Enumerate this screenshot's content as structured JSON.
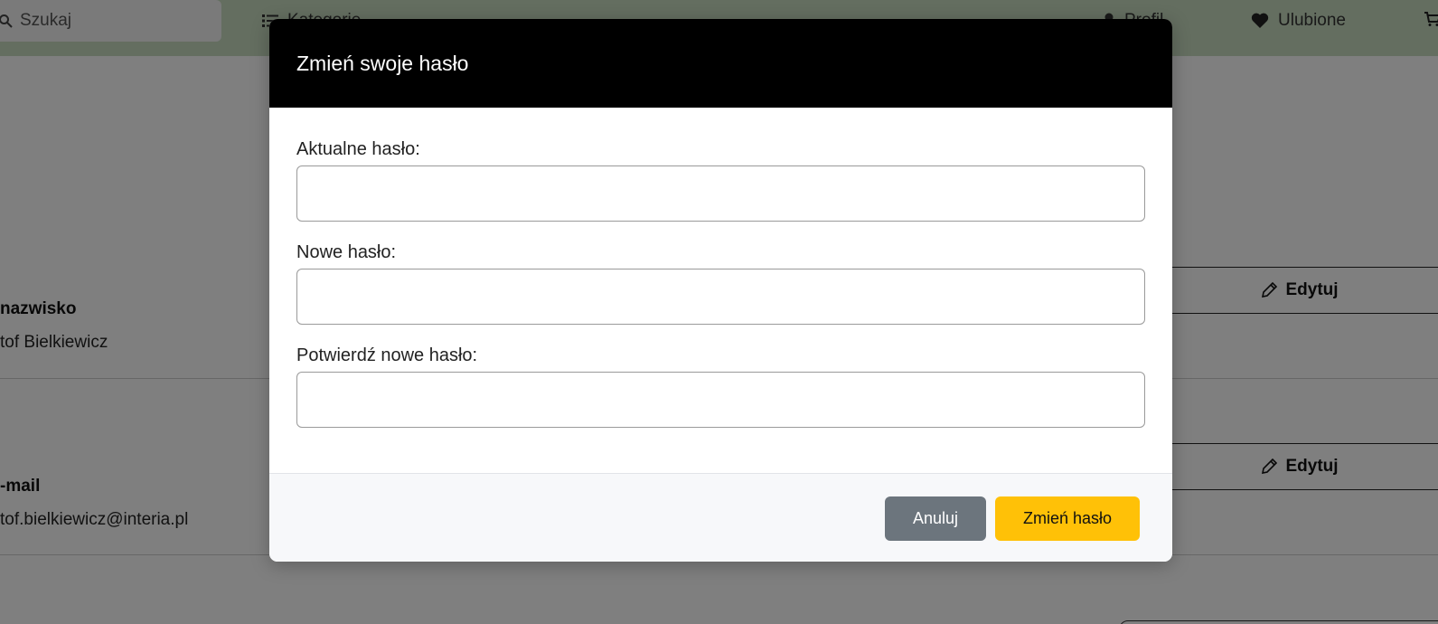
{
  "topbar": {
    "search_placeholder": "Szukaj",
    "nav": {
      "categories": "Kategorie",
      "profile": "Profil",
      "favorites": "Ulubione"
    }
  },
  "profile": {
    "name_label": "nazwisko",
    "name_value": "tof Bielkiewicz",
    "email_label": "-mail",
    "email_value": "tof.bielkiewicz@interia.pl",
    "edit_label": "Edytuj"
  },
  "modal": {
    "title": "Zmień swoje hasło",
    "fields": [
      {
        "label": "Aktualne hasło:",
        "value": ""
      },
      {
        "label": "Nowe hasło:",
        "value": ""
      },
      {
        "label": "Potwierdź nowe hasło:",
        "value": ""
      }
    ],
    "cancel_label": "Anuluj",
    "submit_label": "Zmień hasło"
  },
  "colors": {
    "header_bg": "#000000",
    "cancel_bg": "#6c757d",
    "submit_bg": "#ffc107",
    "topbar_bg": "#c8dcc0"
  }
}
